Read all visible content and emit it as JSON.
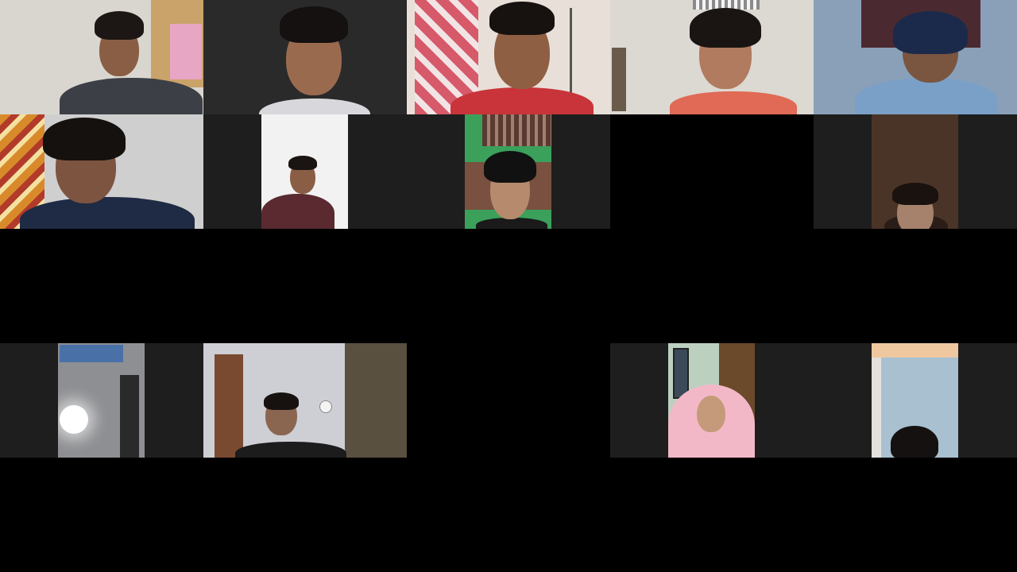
{
  "meeting": {
    "layout": "gallery",
    "grid": {
      "columns": 5,
      "rows": 5
    }
  },
  "participants": [
    {
      "id": "p1",
      "camera": "on",
      "framing": "landscape",
      "background": "#d9d6d0",
      "shirt_color": "#3c4046"
    },
    {
      "id": "p2",
      "camera": "on",
      "framing": "landscape",
      "background": "#2a2a2a",
      "shirt_color": "#d8d8dc"
    },
    {
      "id": "p3",
      "camera": "on",
      "framing": "landscape",
      "background": "#e8e0d8",
      "shirt_color": "#c8343a"
    },
    {
      "id": "p4",
      "camera": "on",
      "framing": "landscape",
      "background": "#dcd8d2",
      "shirt_color": "#e06a55"
    },
    {
      "id": "p5",
      "camera": "on",
      "framing": "landscape",
      "background": "#8aa0b8",
      "shirt_color": "#7aa0c8"
    },
    {
      "id": "p6",
      "camera": "on",
      "framing": "landscape",
      "background": "#cfcfcf",
      "shirt_color": "#1f2a44"
    },
    {
      "id": "p7",
      "camera": "on",
      "framing": "portrait",
      "background": "#f2f2f2",
      "shirt_color": "#5a2a30"
    },
    {
      "id": "p8",
      "camera": "on",
      "framing": "portrait",
      "background": "#3aa05a",
      "shirt_color": "#1a1a1a"
    },
    {
      "id": "p9",
      "camera": "off"
    },
    {
      "id": "p10",
      "camera": "on",
      "framing": "portrait",
      "background": "#4a3428",
      "shirt_color": "#2a1c16"
    },
    {
      "id": "p11",
      "camera": "on",
      "framing": "portrait",
      "background": "#8d8f92",
      "shirt_color": "#222222"
    },
    {
      "id": "p12",
      "camera": "on",
      "framing": "landscape",
      "background": "#cdcfd4",
      "shirt_color": "#1c1c1c"
    },
    {
      "id": "p13",
      "camera": "off"
    },
    {
      "id": "p14",
      "camera": "on",
      "framing": "portrait",
      "background": "#bcd0c0",
      "shirt_color": "#f3b8c8"
    },
    {
      "id": "p15",
      "camera": "on",
      "framing": "portrait",
      "background": "#a8c0d0",
      "shirt_color": "#2a2a2a"
    }
  ]
}
